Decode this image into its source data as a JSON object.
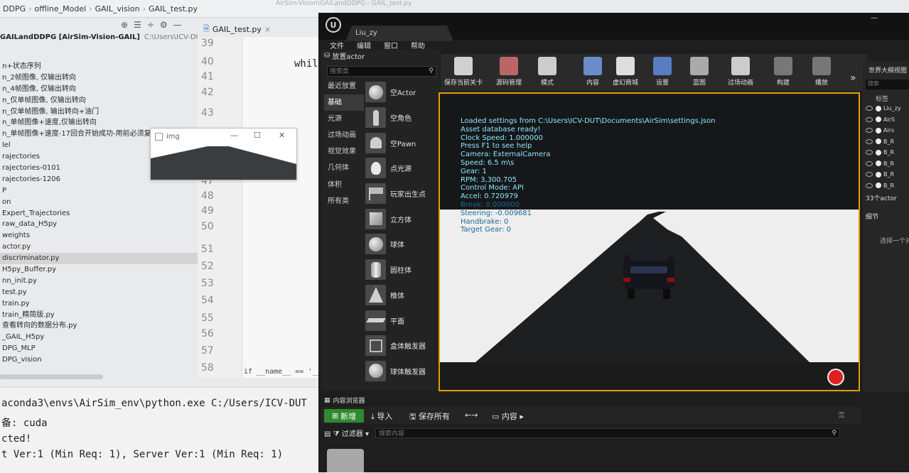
{
  "ide": {
    "breadcrumb": [
      "DDPG",
      "offline_Model",
      "GAIL_vision",
      "GAIL_test.py"
    ],
    "project_name": "GAILandDDPG [AirSim-Vision-GAIL]",
    "project_path": "C:\\Users\\ICV-DUT\\De",
    "toolbar_icons": [
      "target-icon",
      "collapse-icon",
      "expand-icon",
      "gear-icon",
      "minimize-icon"
    ],
    "tree": [
      "n+状态序列",
      "n_2帧图像, 仅输出转向",
      "n_4帧图像, 仅输出转向",
      "n_仅单帧图像, 仅输出转向",
      "n_仅单帧图像, 输出转向+油门",
      "n_单帧图像+速度,仅输出转向",
      "n_单帧图像+速度-17回合开始成功-用前必须复制",
      "lel",
      "rajectories",
      "rajectories-0101",
      "rajectories-1206",
      "P",
      "on",
      "Expert_Trajectories",
      "raw_data_H5py",
      "weights",
      "actor.py",
      "discriminator.py",
      "H5py_Buffer.py",
      "nn_init.py",
      "test.py",
      "train.py",
      "train_精简版.py",
      "查看转向的数据分布.py",
      "_GAIL_H5py",
      "DPG_MLP",
      "DPG_vision"
    ],
    "selected_index": 17,
    "tab_label": "GAIL_test.py",
    "line_numbers": [
      "39",
      "40",
      "41",
      "42",
      "43",
      "47",
      "48",
      "49",
      "50",
      "51",
      "52",
      "53",
      "54",
      "55",
      "56",
      "57",
      "58"
    ],
    "code_while": "while",
    "code_main": "if __name__ == '__main",
    "console": [
      "aconda3\\envs\\AirSim_env\\python.exe C:/Users/ICV-DUT",
      "备: cuda",
      "cted!",
      "t Ver:1 (Min Req: 1), Server Ver:1 (Min Req: 1)"
    ]
  },
  "img_window": {
    "title": "img",
    "controls": [
      "—",
      "☐",
      "✕"
    ]
  },
  "ue": {
    "titlebar_path": "AirSim-Vision\\GAILandDDPG - GAIL_test.py",
    "tab_label": "Liu_zy",
    "menus": [
      "文件",
      "编辑",
      "窗口",
      "帮助"
    ],
    "place_tab": "放置actor",
    "search_placeholder": "搜索类",
    "categories": [
      "最近放置",
      "基础",
      "光源",
      "过场动画",
      "视觉效果",
      "几何体",
      "体积",
      "所有类"
    ],
    "active_category": 1,
    "actors": [
      {
        "label": "空Actor",
        "icon": "sphere"
      },
      {
        "label": "空角色",
        "icon": "person"
      },
      {
        "label": "空Pawn",
        "icon": "pawn"
      },
      {
        "label": "点光源",
        "icon": "light"
      },
      {
        "label": "玩家出生点",
        "icon": "flag"
      },
      {
        "label": "立方体",
        "icon": "cube"
      },
      {
        "label": "球体",
        "icon": "sphere"
      },
      {
        "label": "圆柱体",
        "icon": "cyl"
      },
      {
        "label": "椎体",
        "icon": "cone"
      },
      {
        "label": "平面",
        "icon": "plane"
      },
      {
        "label": "盒体触发器",
        "icon": "box-outline"
      },
      {
        "label": "球体触发器",
        "icon": "sphere"
      }
    ],
    "toolbar": [
      {
        "label": "保存当前关卡",
        "icon": "save-icon"
      },
      {
        "label": "源码管理",
        "icon": "source-control-icon"
      },
      {
        "label": "模式",
        "icon": "modes-icon"
      },
      {
        "label": "内容",
        "icon": "content-icon"
      },
      {
        "label": "虚幻商城",
        "icon": "marketplace-icon"
      },
      {
        "label": "设置",
        "icon": "settings-icon"
      },
      {
        "label": "蓝图",
        "icon": "blueprint-icon"
      },
      {
        "label": "过场动画",
        "icon": "cinematics-icon"
      },
      {
        "label": "构建",
        "icon": "build-icon"
      },
      {
        "label": "播放",
        "icon": "play-icon"
      }
    ],
    "viewport_overlay": [
      "Loaded settings from C:\\Users\\ICV-DUT\\Documents\\AirSim\\settings.json",
      "Asset database ready!",
      "Clock Speed: 1.000000",
      "Press F1 to see help",
      "Camera: ExternalCamera",
      "Speed: 6.5 m\\s",
      "Gear: 1",
      "RPM: 3,300.705",
      "Control Mode: API",
      "Accel: 0.720979",
      "Break: 0.000000",
      "Steering: -0.009681",
      "Handbrake: 0",
      "Target Gear: 0"
    ],
    "outliner_title": "世界大纲视图",
    "outliner_search": "搜索",
    "outliner_header": "标签",
    "outliner_rows": [
      "Liu_zy",
      "AirS",
      "Airs",
      "B_R",
      "B_R",
      "B_R",
      "B_R",
      "B_R"
    ],
    "actor_count": "33个actor",
    "details_tab": "细节",
    "details_hint": "选择一个对",
    "content_tab": "内容浏览器",
    "cb_new": "新增",
    "cb_import": "导入",
    "cb_save_all": "保存所有",
    "cb_content": "内容",
    "cb_filter": "过滤器",
    "cb_search_placeholder": "搜索内容"
  }
}
